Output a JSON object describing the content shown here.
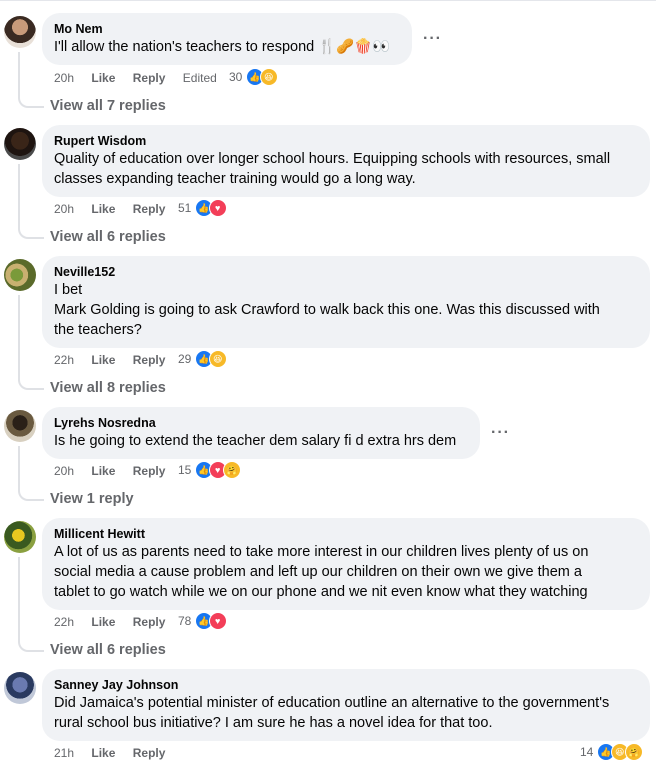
{
  "comments": [
    {
      "author": "Mo Nem",
      "lines": [
        "I'll allow the nation's teachers to respond 🍴🥜🍿👀"
      ],
      "time": "20h",
      "like": "Like",
      "reply": "Reply",
      "edited": "Edited",
      "count": "30",
      "reactions": [
        "like-icon",
        "haha-icon"
      ],
      "view": "View all 7 replies"
    },
    {
      "author": "Rupert Wisdom",
      "lines": [
        "Quality of education over longer school hours. Equipping schools with resources, small",
        "classes expanding teacher training would go a long way."
      ],
      "time": "20h",
      "like": "Like",
      "reply": "Reply",
      "count": "51",
      "reactions": [
        "like-icon",
        "love-icon"
      ],
      "view": "View all 6 replies"
    },
    {
      "author": "Neville152",
      "lines": [
        "I bet",
        "Mark Golding is going to ask Crawford to walk back this one. Was this discussed with",
        "the teachers?"
      ],
      "time": "22h",
      "like": "Like",
      "reply": "Reply",
      "count": "29",
      "reactions": [
        "like-icon",
        "haha-icon"
      ],
      "view": "View all 8 replies"
    },
    {
      "author": "Lyrehs Nosredna",
      "lines": [
        "Is he going to extend the teacher dem salary fi d extra hrs dem"
      ],
      "time": "20h",
      "like": "Like",
      "reply": "Reply",
      "count": "15",
      "reactions": [
        "like-icon",
        "love-icon",
        "care-icon"
      ],
      "view": "View 1 reply"
    },
    {
      "author": "Millicent Hewitt",
      "lines": [
        "A lot of us as parents need to take more interest in our children lives plenty of us on",
        "social media a cause problem and left up our children on their own we give them a",
        "tablet to go watch while we on our phone and we nit even know what they watching"
      ],
      "time": "22h",
      "like": "Like",
      "reply": "Reply",
      "count": "78",
      "reactions": [
        "like-icon",
        "love-icon"
      ],
      "view": "View all 6 replies"
    },
    {
      "author": "Sanney Jay Johnson",
      "lines": [
        "Did Jamaica's potential minister of education outline an alternative to the government's",
        "rural school bus initiative? I am sure he has a novel idea for that too."
      ],
      "time": "21h",
      "like": "Like",
      "reply": "Reply",
      "count": "14",
      "reactions": [
        "like-icon",
        "haha-icon",
        "care-icon"
      ]
    }
  ],
  "more_label": "···",
  "colors": {
    "bubble": "#f0f2f5",
    "meta": "#65676b",
    "like": "#1877f2",
    "love": "#f33e58",
    "haha": "#f7b928"
  }
}
